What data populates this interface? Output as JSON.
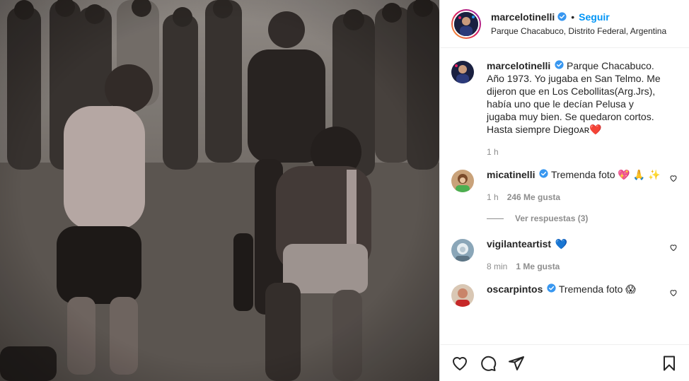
{
  "header": {
    "username": "marcelotinelli",
    "follow_label": "Seguir",
    "location": "Parque Chacabuco, Distrito Federal, Argentina"
  },
  "caption": {
    "username": "marcelotinelli",
    "text": "Parque Chacabuco. Año 1973. Yo jugaba en San Telmo. Me dijeron que en Los Cebollitas(Arg.Jrs), había uno que le decían Pelusa y jugaba muy bien. Se quedaron cortos. Hasta siempre Diegoᴀʀ❤️",
    "time": "1 h"
  },
  "comments": [
    {
      "username": "micatinelli",
      "text": "Tremenda foto 💖 🙏 ✨",
      "time": "1 h",
      "likes": "246 Me gusta"
    },
    {
      "username": "vigilanteartist",
      "text": "💙",
      "time": "8 min",
      "likes": "1 Me gusta"
    },
    {
      "username": "oscarpintos",
      "text": "Tremenda foto 😱"
    }
  ],
  "replies_label": "Ver respuestas (3)",
  "colors": {
    "follow": "#0095f6",
    "verified": "#3897f0",
    "secondary": "#8e8e8e"
  }
}
